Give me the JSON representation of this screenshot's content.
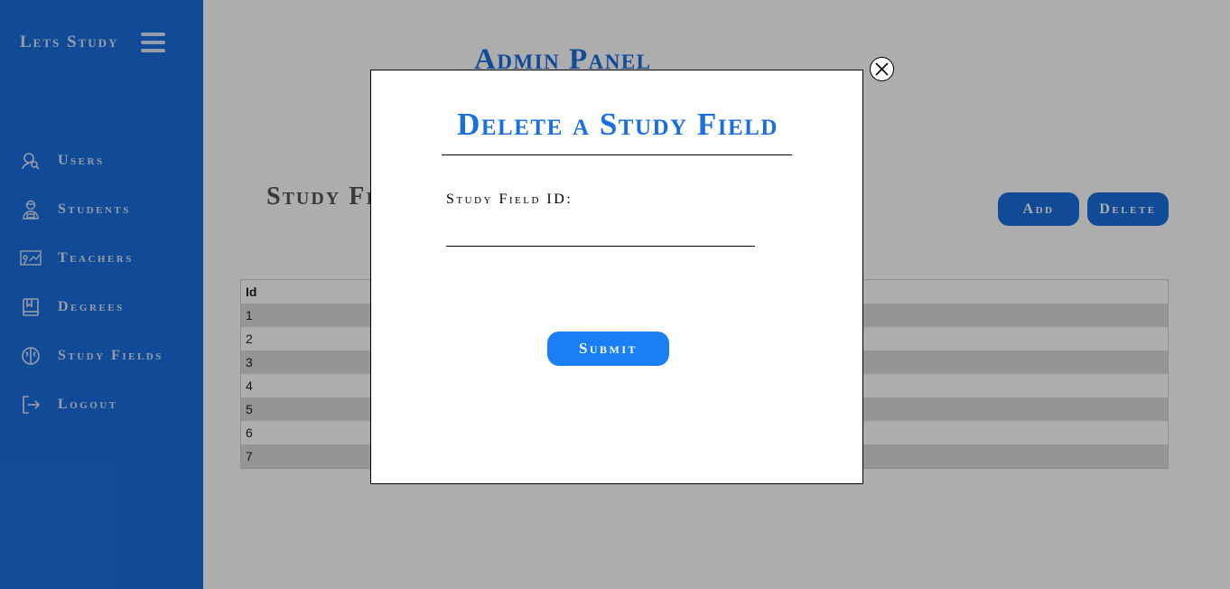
{
  "sidebar": {
    "brand": "Lets Study",
    "menu_icon": "hamburger-menu-icon",
    "items": [
      {
        "label": "Users",
        "icon": "user-search-icon"
      },
      {
        "label": "Students",
        "icon": "student-icon"
      },
      {
        "label": "Teachers",
        "icon": "teacher-board-icon"
      },
      {
        "label": "Degrees",
        "icon": "book-icon"
      },
      {
        "label": "Study Fields",
        "icon": "brain-icon"
      },
      {
        "label": "Logout",
        "icon": "logout-icon"
      }
    ]
  },
  "main": {
    "title": "Admin Panel",
    "section_title": "Study Fields",
    "add_label": "Add",
    "delete_label": "Delete",
    "table": {
      "header": "Id",
      "rows": [
        "1",
        "2",
        "3",
        "4",
        "5",
        "6",
        "7"
      ]
    }
  },
  "modal": {
    "title": "Delete a Study Field",
    "field_label": "Study Field ID:",
    "field_value": "",
    "submit_label": "Submit",
    "close_icon": "close-icon"
  },
  "colors": {
    "sidebar": "#1a6fe0",
    "accent": "#1a7ff5",
    "overlay": "rgba(0,0,0,0.32)"
  }
}
